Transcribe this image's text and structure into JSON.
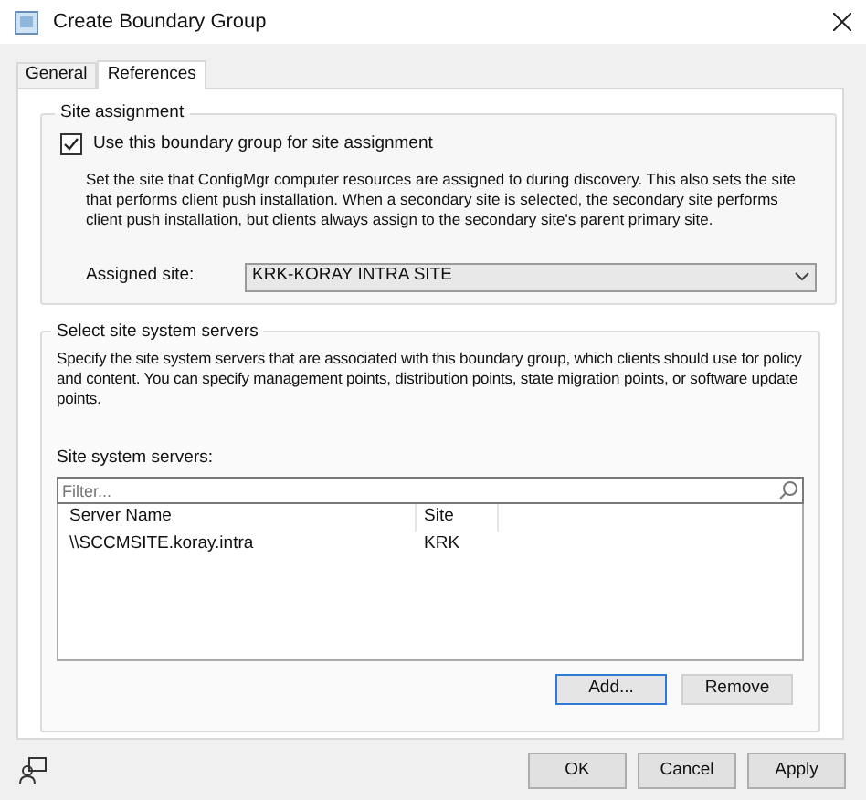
{
  "window": {
    "title": "Create Boundary Group"
  },
  "tabs": [
    {
      "label": "General",
      "selected": false
    },
    {
      "label": "References",
      "selected": true
    }
  ],
  "site_assignment": {
    "legend": "Site assignment",
    "checkbox": {
      "label": "Use this boundary group for site assignment",
      "checked": true
    },
    "description": "Set the site that ConfigMgr computer resources are assigned to during discovery. This also sets the site that performs client push installation. When a secondary site is selected, the secondary site performs client push installation, but clients always assign to the secondary site's parent primary site.",
    "assigned_site": {
      "label": "Assigned site:",
      "value": "KRK-KORAY INTRA SITE"
    }
  },
  "site_system_servers": {
    "legend": "Select site system servers",
    "description": "Specify the site system servers that are associated with this boundary group, which clients should use for policy and content. You can specify management points, distribution points, state migration points, or software update points.",
    "list_label": "Site system servers:",
    "filter": {
      "placeholder": "Filter..."
    },
    "table": {
      "columns": [
        "Server Name",
        "Site"
      ],
      "rows": [
        [
          "\\\\SCCMSITE.koray.intra",
          "KRK"
        ]
      ]
    },
    "buttons": [
      {
        "label": "Add...",
        "disabled": false,
        "focused": true
      },
      {
        "label": "Remove",
        "disabled": true,
        "focused": false
      }
    ]
  },
  "buttons": [
    {
      "label": "OK"
    },
    {
      "label": "Cancel"
    },
    {
      "label": "Apply"
    }
  ]
}
